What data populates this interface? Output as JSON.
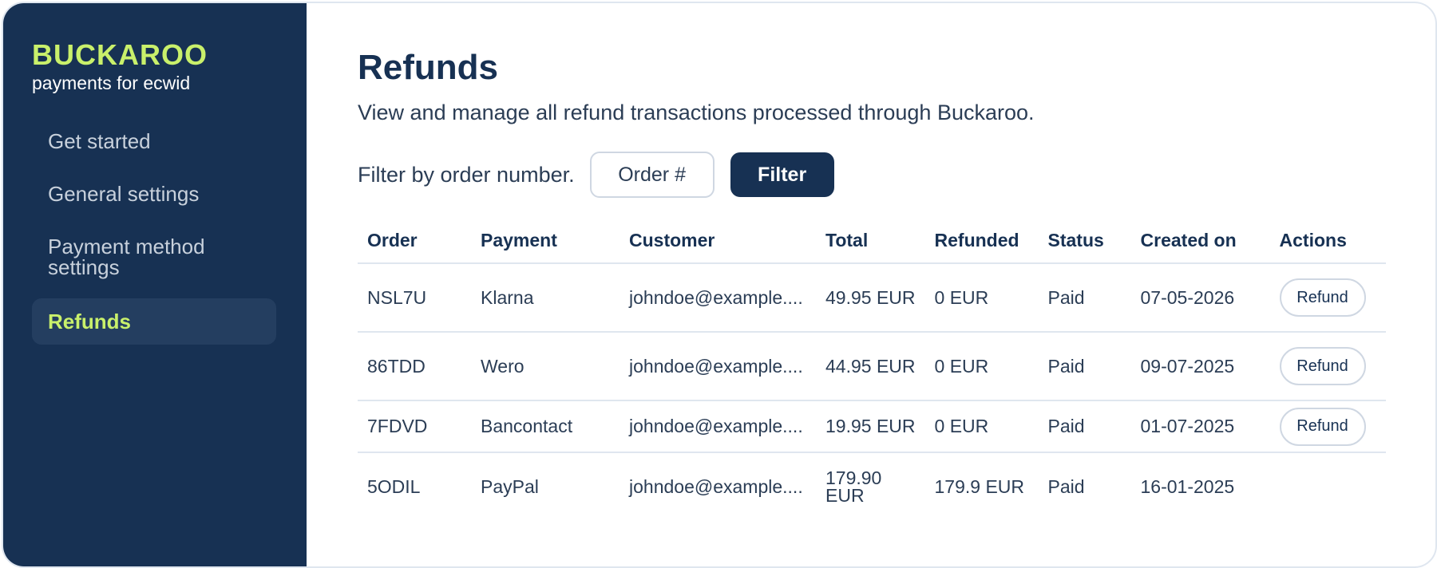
{
  "sidebar": {
    "brand_title": "BUCKAROO",
    "brand_subtitle": "payments for ecwid",
    "items": [
      {
        "label": "Get started"
      },
      {
        "label": "General settings"
      },
      {
        "label": "Payment method settings"
      },
      {
        "label": "Refunds"
      }
    ],
    "active_index": 3
  },
  "main": {
    "title": "Refunds",
    "description": "View and manage all refund transactions processed through Buckaroo.",
    "filter": {
      "label": "Filter by order number.",
      "placeholder": "Order #",
      "button_label": "Filter"
    },
    "table": {
      "headers": [
        "Order",
        "Payment",
        "Customer",
        "Total",
        "Refunded",
        "Status",
        "Created on",
        "Actions"
      ],
      "rows": [
        {
          "order": "NSL7U",
          "payment": "Klarna",
          "customer": "johndoe@example....",
          "total": "49.95 EUR",
          "refunded": "0 EUR",
          "status": "Paid",
          "created_on": "07-05-2026",
          "action": "Refund"
        },
        {
          "order": "86TDD",
          "payment": "Wero",
          "customer": "johndoe@example....",
          "total": "44.95 EUR",
          "refunded": "0 EUR",
          "status": "Paid",
          "created_on": "09-07-2025",
          "action": "Refund"
        },
        {
          "order": "7FDVD",
          "payment": "Bancontact",
          "customer": "johndoe@example....",
          "total": "19.95 EUR",
          "refunded": "0 EUR",
          "status": "Paid",
          "created_on": "01-07-2025",
          "action": "Refund"
        },
        {
          "order": "5ODIL",
          "payment": "PayPal",
          "customer": "johndoe@example....",
          "total": "179.90 EUR",
          "refunded": "179.9 EUR",
          "status": "Paid",
          "created_on": "16-01-2025",
          "action": ""
        }
      ]
    }
  },
  "colors": {
    "sidebar_bg": "#173153",
    "accent": "#c9f06b",
    "primary": "#173153"
  }
}
